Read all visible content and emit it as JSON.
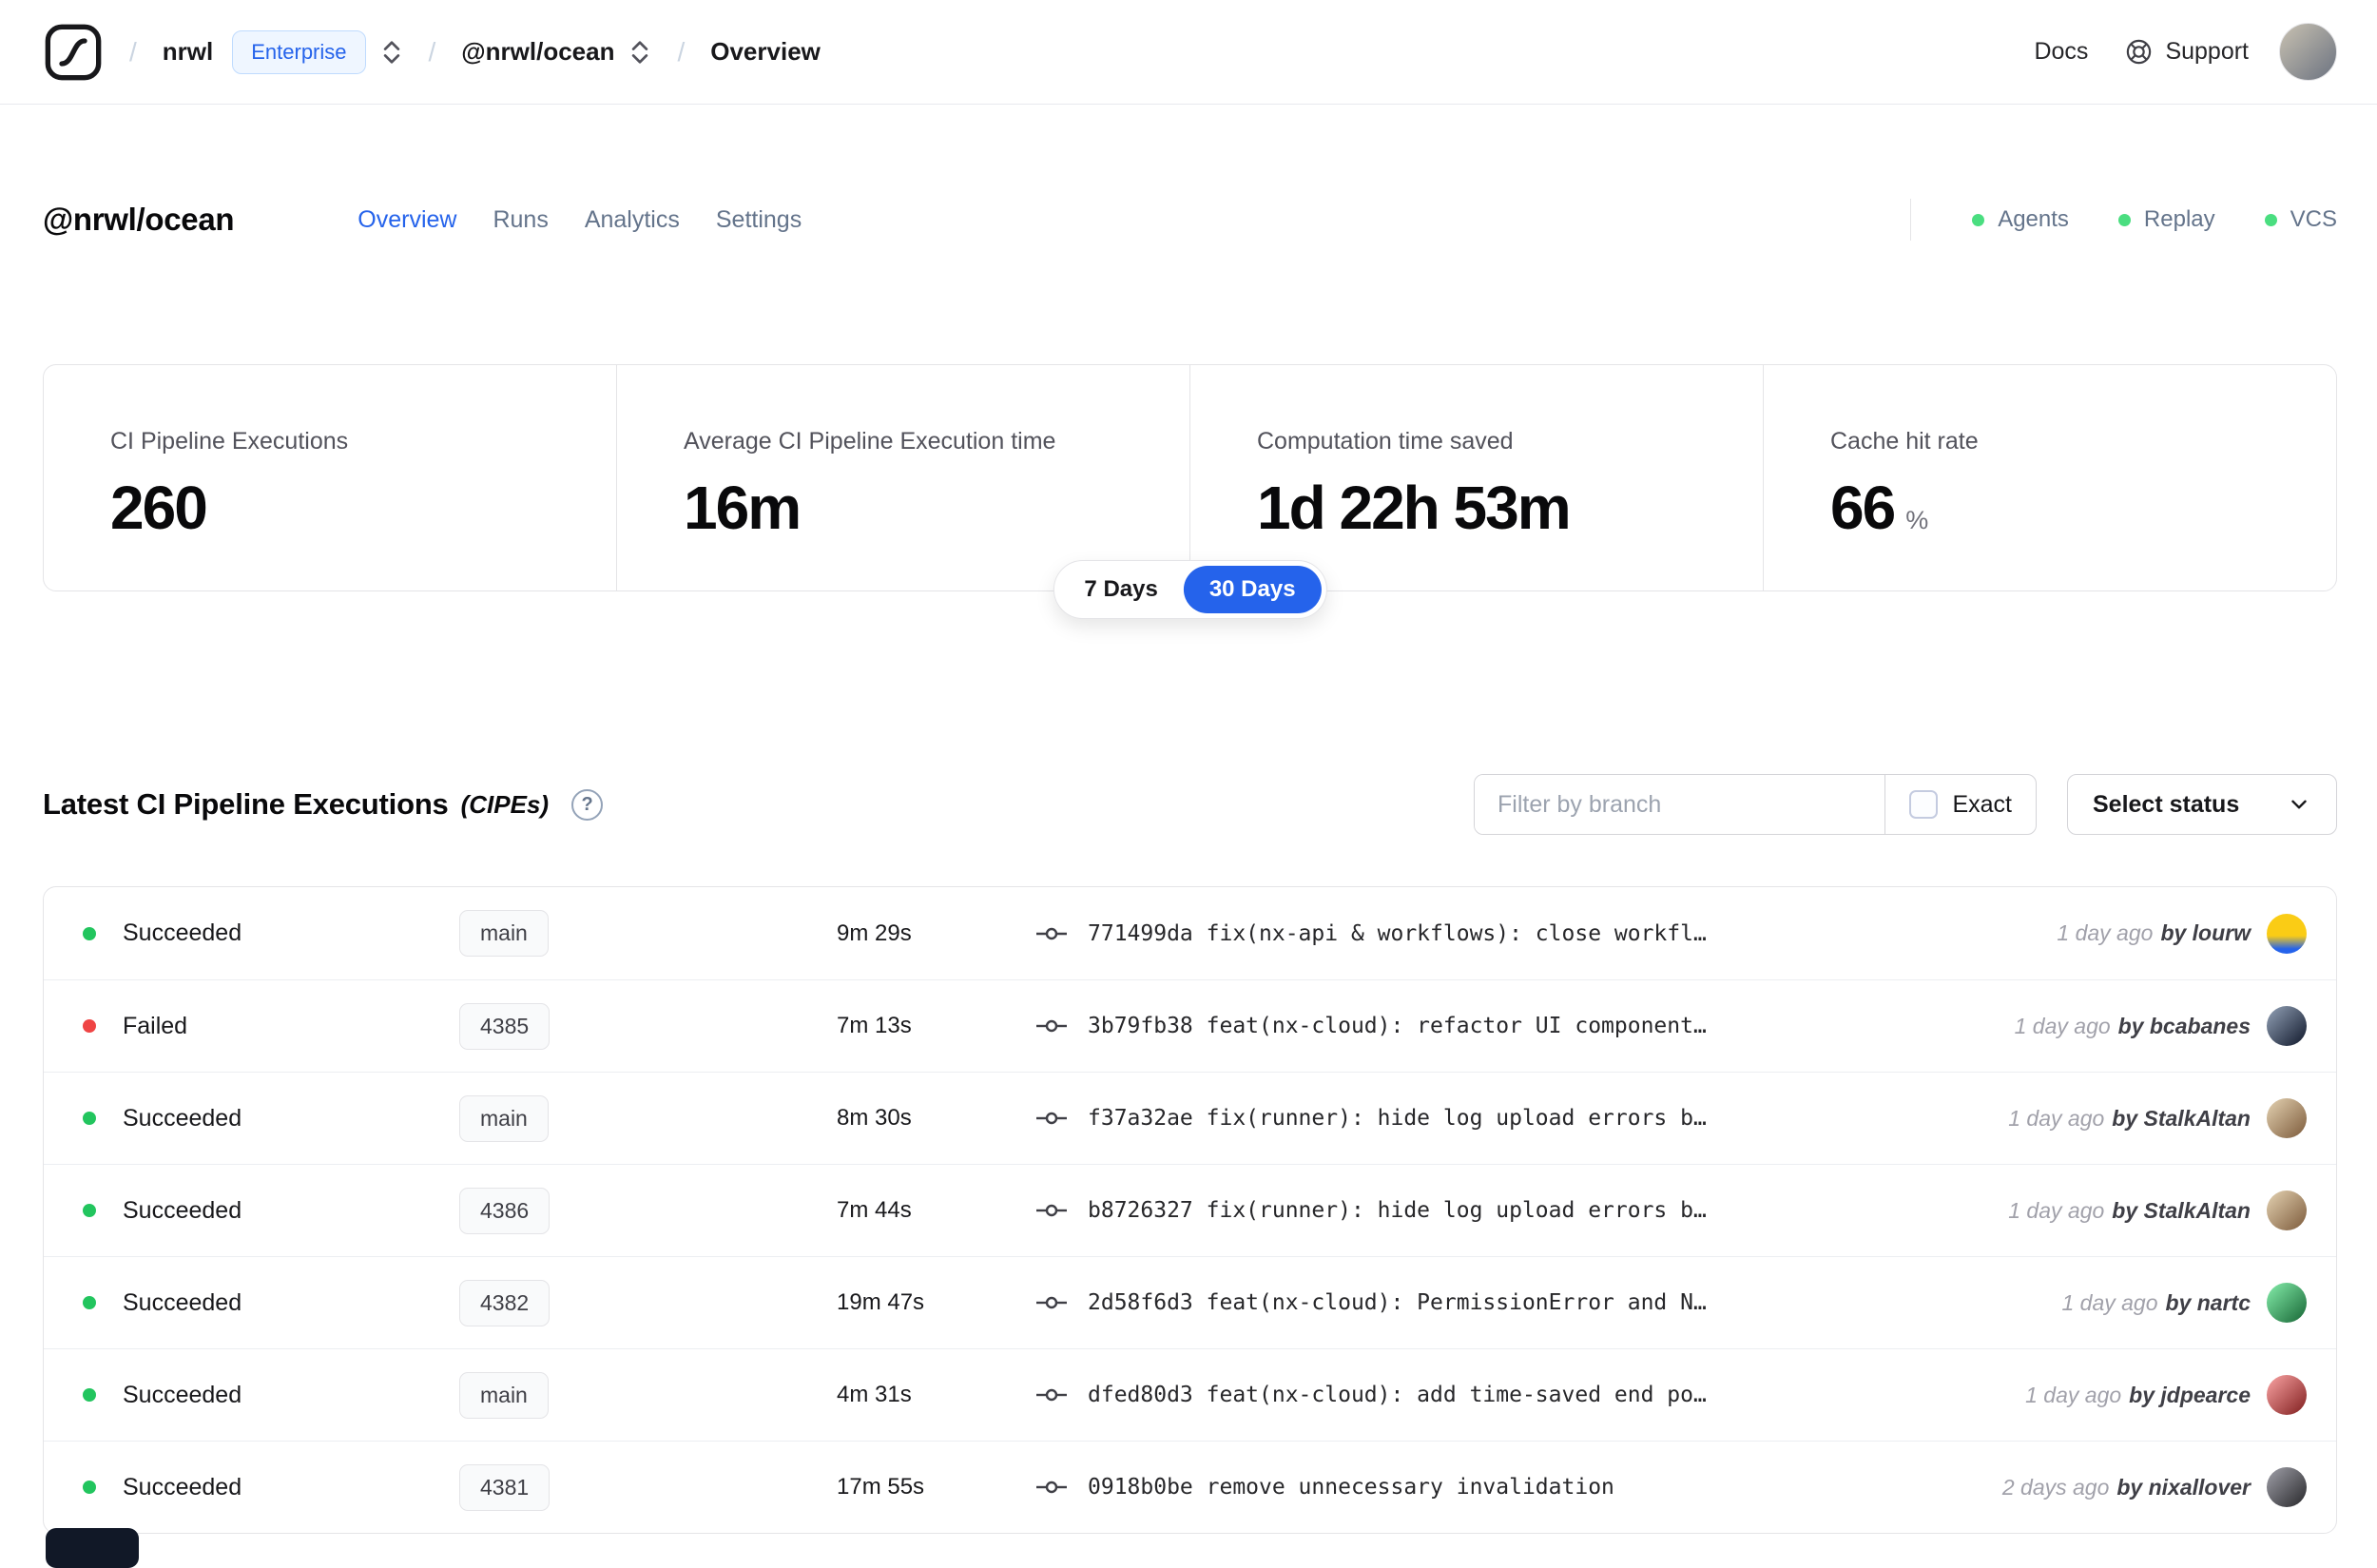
{
  "navbar": {
    "separator": "/",
    "org": "nrwl",
    "plan_badge": "Enterprise",
    "workspace": "@nrwl/ocean",
    "page": "Overview",
    "docs_label": "Docs",
    "support_label": "Support"
  },
  "header": {
    "title": "@nrwl/ocean",
    "tabs": {
      "overview": "Overview",
      "runs": "Runs",
      "analytics": "Analytics",
      "settings": "Settings"
    },
    "statuses": {
      "agents": "Agents",
      "replay": "Replay",
      "vcs": "VCS"
    },
    "status_dot_color": "#4ade80"
  },
  "metrics": {
    "cards": [
      {
        "label": "CI Pipeline Executions",
        "value": "260",
        "suffix": ""
      },
      {
        "label": "Average CI Pipeline Execution time",
        "value": "16m",
        "suffix": ""
      },
      {
        "label": "Computation time saved",
        "value": "1d 22h 53m",
        "suffix": ""
      },
      {
        "label": "Cache hit rate",
        "value": "66",
        "suffix": "%"
      }
    ],
    "toggle": {
      "seven": "7 Days",
      "thirty": "30 Days",
      "active": "30 Days",
      "active_color": "#2563eb"
    }
  },
  "cipes": {
    "title": "Latest CI Pipeline Executions",
    "subtitle": "(CIPEs)",
    "help_glyph": "?",
    "filter_placeholder": "Filter by branch",
    "exact_label": "Exact",
    "select_status_label": "Select status",
    "rows": [
      {
        "status": "Succeeded",
        "dot_style": "background:#22c55e",
        "branch": "main",
        "duration": "9m 29s",
        "commit": "771499da fix(nx-api & workflows): close workfl…",
        "time": "1 day ago",
        "author": "by lourw",
        "avatar_style": "background:linear-gradient(180deg,#facc15 55%,#2563eb 88%)"
      },
      {
        "status": "Failed",
        "dot_style": "background:#ef4444",
        "branch": "4385",
        "duration": "7m 13s",
        "commit": "3b79fb38 feat(nx-cloud): refactor UI component…",
        "time": "1 day ago",
        "author": "by bcabanes",
        "avatar_style": "background:linear-gradient(135deg,#94a3b8,#0f172a)"
      },
      {
        "status": "Succeeded",
        "dot_style": "background:#22c55e",
        "branch": "main",
        "duration": "8m 30s",
        "commit": "f37a32ae fix(runner): hide log upload errors b…",
        "time": "1 day ago",
        "author": "by StalkAltan",
        "avatar_style": "background:linear-gradient(135deg,#e5d3b3,#7c5a3a)"
      },
      {
        "status": "Succeeded",
        "dot_style": "background:#22c55e",
        "branch": "4386",
        "duration": "7m 44s",
        "commit": "b8726327 fix(runner): hide log upload errors b…",
        "time": "1 day ago",
        "author": "by StalkAltan",
        "avatar_style": "background:linear-gradient(135deg,#e5d3b3,#7c5a3a)"
      },
      {
        "status": "Succeeded",
        "dot_style": "background:#22c55e",
        "branch": "4382",
        "duration": "19m 47s",
        "commit": "2d58f6d3 feat(nx-cloud): PermissionError and N…",
        "time": "1 day ago",
        "author": "by nartc",
        "avatar_style": "background:linear-gradient(135deg,#86efac,#166534)"
      },
      {
        "status": "Succeeded",
        "dot_style": "background:#22c55e",
        "branch": "main",
        "duration": "4m 31s",
        "commit": "dfed80d3 feat(nx-cloud): add time-saved end po…",
        "time": "1 day ago",
        "author": "by jdpearce",
        "avatar_style": "background:linear-gradient(135deg,#fca5a5,#7f1d1d)"
      },
      {
        "status": "Succeeded",
        "dot_style": "background:#22c55e",
        "branch": "4381",
        "duration": "17m 55s",
        "commit": "0918b0be remove unnecessary invalidation",
        "time": "2 days ago",
        "author": "by nixallover",
        "avatar_style": "background:linear-gradient(135deg,#a1a1aa,#27272a)"
      }
    ]
  }
}
